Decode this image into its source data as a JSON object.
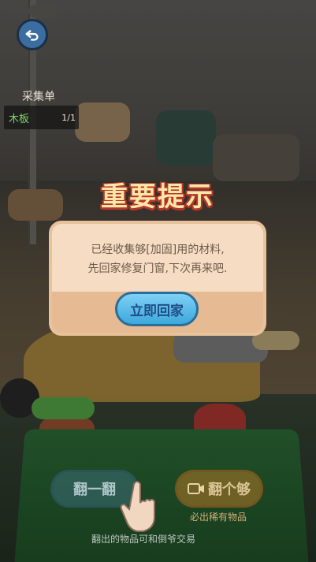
{
  "shopping_list": {
    "title": "采集单",
    "items": [
      {
        "name": "木板",
        "count": "1/1"
      }
    ]
  },
  "dialog": {
    "title": "重要提示",
    "message_line1": "已经收集够[加固]用的材料,",
    "message_line2": "先回家修复门窗,下次再来吧.",
    "confirm_label": "立即回家"
  },
  "actions": {
    "flip_label": "翻一翻",
    "flip_all_label": "翻个够",
    "flip_all_icon": "video-icon",
    "flip_all_hint": "必出稀有物品"
  },
  "footer": {
    "text": "翻出的物品可和倒爷交易"
  },
  "colors": {
    "title_fill": "#ffe7a8",
    "title_outline": "#b4372a",
    "dialog_bg": "#f6dcc2",
    "confirm_blue": "#3ea8dc",
    "list_item_green": "#7fd46a"
  }
}
